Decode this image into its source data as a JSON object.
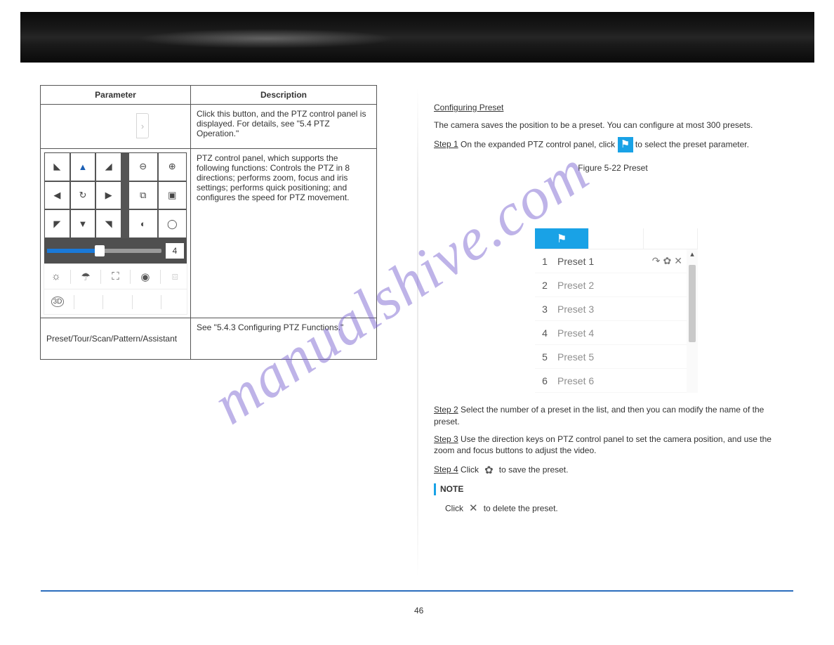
{
  "table": {
    "hdr_param": "Parameter",
    "hdr_desc": "Description",
    "row2_desc": "Click this button, and the PTZ control panel is displayed. For details, see \"5.4 PTZ Operation.\"",
    "row3_desc": "PTZ control panel, which supports the following functions: Controls the PTZ in 8 directions; performs zoom, focus and iris settings; performs quick positioning; and configures the speed for PTZ movement.",
    "row4_param": "Preset/Tour/Scan/Pattern/Assistant",
    "row4_desc": "See \"5.4.3 Configuring PTZ Functions.\""
  },
  "ptz": {
    "speed": "4"
  },
  "right": {
    "title": "Configuring Preset",
    "intro": "The camera saves the position to be a preset. You can configure at most 300 presets.",
    "step1_num": "Step 1",
    "step1_body": "On the expanded PTZ control panel, click",
    "step1_tail": "to select the preset parameter.",
    "fig_caption": "Figure 5-22  Preset",
    "step2_num": "Step 2",
    "step2_body": "Select the number of a preset in the list, and then you can modify the name of the preset.",
    "step3_num": "Step 3",
    "step3_body": "Use the direction keys on PTZ control panel to set the camera position, and use the zoom and focus buttons to adjust the video.",
    "step4_num": "Step 4",
    "step4_body": "Click ",
    "step4_ico_desc": "to save the preset.",
    "note_label": "NOTE",
    "note_body": "Click",
    "note_tail": "to delete the preset."
  },
  "presets": {
    "items": [
      {
        "n": "1",
        "label": "Preset 1"
      },
      {
        "n": "2",
        "label": "Preset 2"
      },
      {
        "n": "3",
        "label": "Preset 3"
      },
      {
        "n": "4",
        "label": "Preset 4"
      },
      {
        "n": "5",
        "label": "Preset 5"
      },
      {
        "n": "6",
        "label": "Preset 6"
      }
    ]
  },
  "watermark": "manualshive.com",
  "pagenum": "46"
}
